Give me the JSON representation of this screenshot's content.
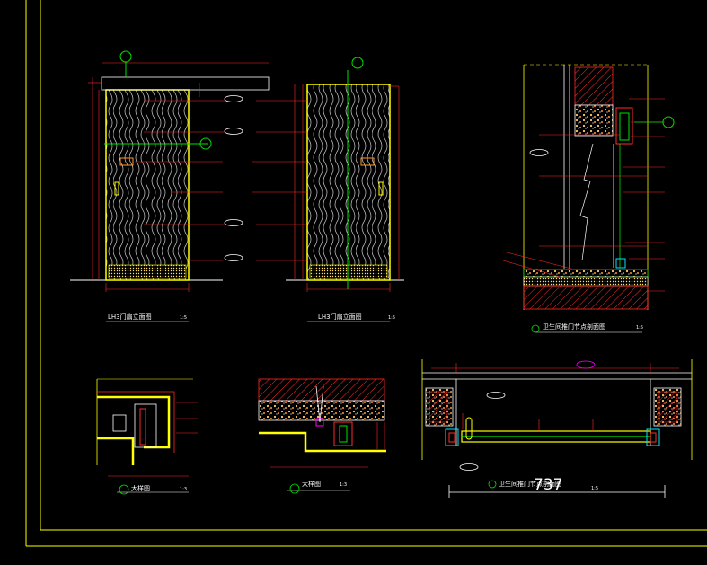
{
  "drawing": {
    "background": "#000000",
    "frame_color": "#ffff00",
    "line_colors": {
      "red": "#ff2a2a",
      "green": "#00e000",
      "yellow": "#ffff00",
      "white": "#ffffff",
      "cyan": "#00e5ff",
      "magenta": "#ff00ff",
      "orange": "#ff9933"
    }
  },
  "views": {
    "front": {
      "title": "LH3门扇立面图",
      "scale": "1:5"
    },
    "back": {
      "title": "LH3门扇立面图",
      "scale": "1:5"
    },
    "section": {
      "title": "卫生间推门节点剖面图",
      "scale": "1:5"
    },
    "plan": {
      "title": "卫生间推门节点剖面图",
      "scale": "1:5",
      "dimension": "737"
    },
    "detail1": {
      "title": "大样图",
      "scale": "1:3"
    },
    "detail2": {
      "title": "大样图",
      "scale": "1:3"
    }
  }
}
